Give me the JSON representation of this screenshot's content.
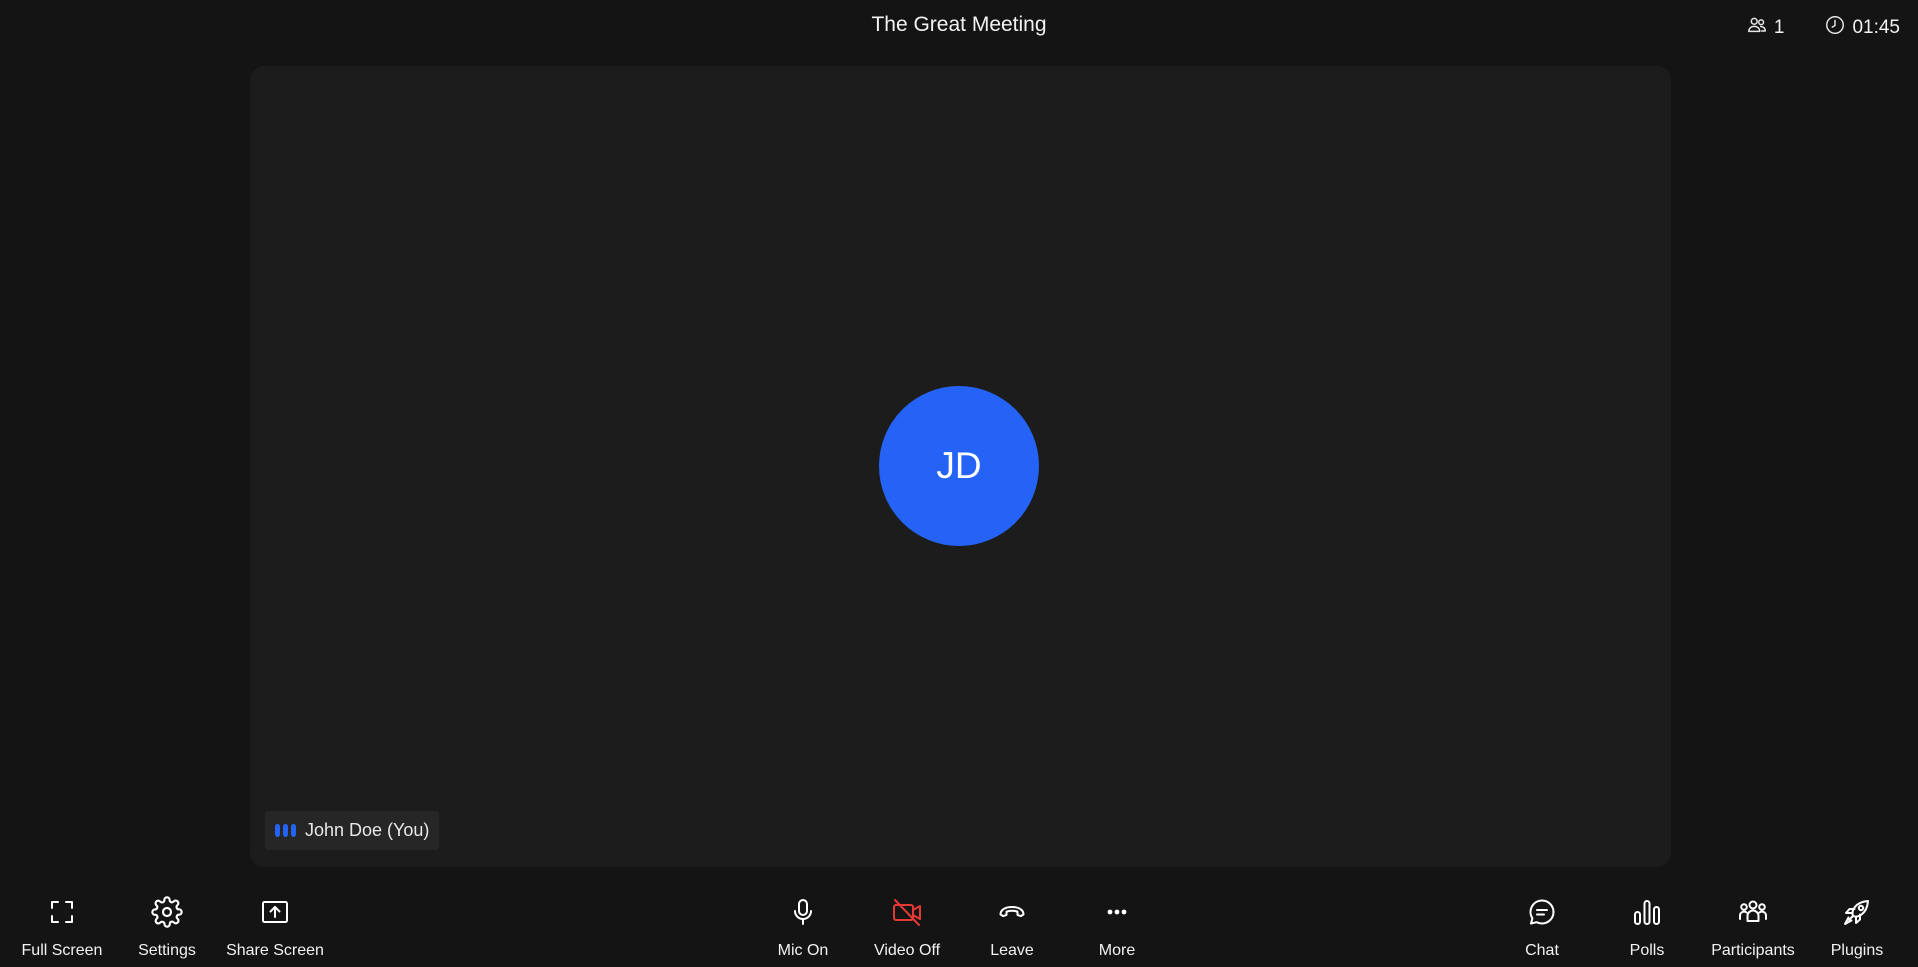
{
  "header": {
    "title": "The Great Meeting",
    "participants_count": "1",
    "timer": "01:45"
  },
  "stage": {
    "avatar_initials": "JD",
    "user_name": "John Doe (You)"
  },
  "toolbar": {
    "left": [
      {
        "label": "Full Screen",
        "icon": "fullscreen-icon"
      },
      {
        "label": "Settings",
        "icon": "gear-icon"
      },
      {
        "label": "Share Screen",
        "icon": "share-screen-icon"
      }
    ],
    "center": [
      {
        "label": "Mic On",
        "icon": "microphone-icon"
      },
      {
        "label": "Video Off",
        "icon": "video-off-icon"
      },
      {
        "label": "Leave",
        "icon": "phone-hangup-icon"
      },
      {
        "label": "More",
        "icon": "more-dots-icon"
      }
    ],
    "right": [
      {
        "label": "Chat",
        "icon": "chat-icon"
      },
      {
        "label": "Polls",
        "icon": "polls-icon"
      },
      {
        "label": "Participants",
        "icon": "participants-icon"
      },
      {
        "label": "Plugins",
        "icon": "rocket-icon"
      }
    ]
  },
  "colors": {
    "accent": "#2563f6",
    "danger": "#e53935",
    "background": "#141414",
    "stage": "#1c1c1c"
  }
}
